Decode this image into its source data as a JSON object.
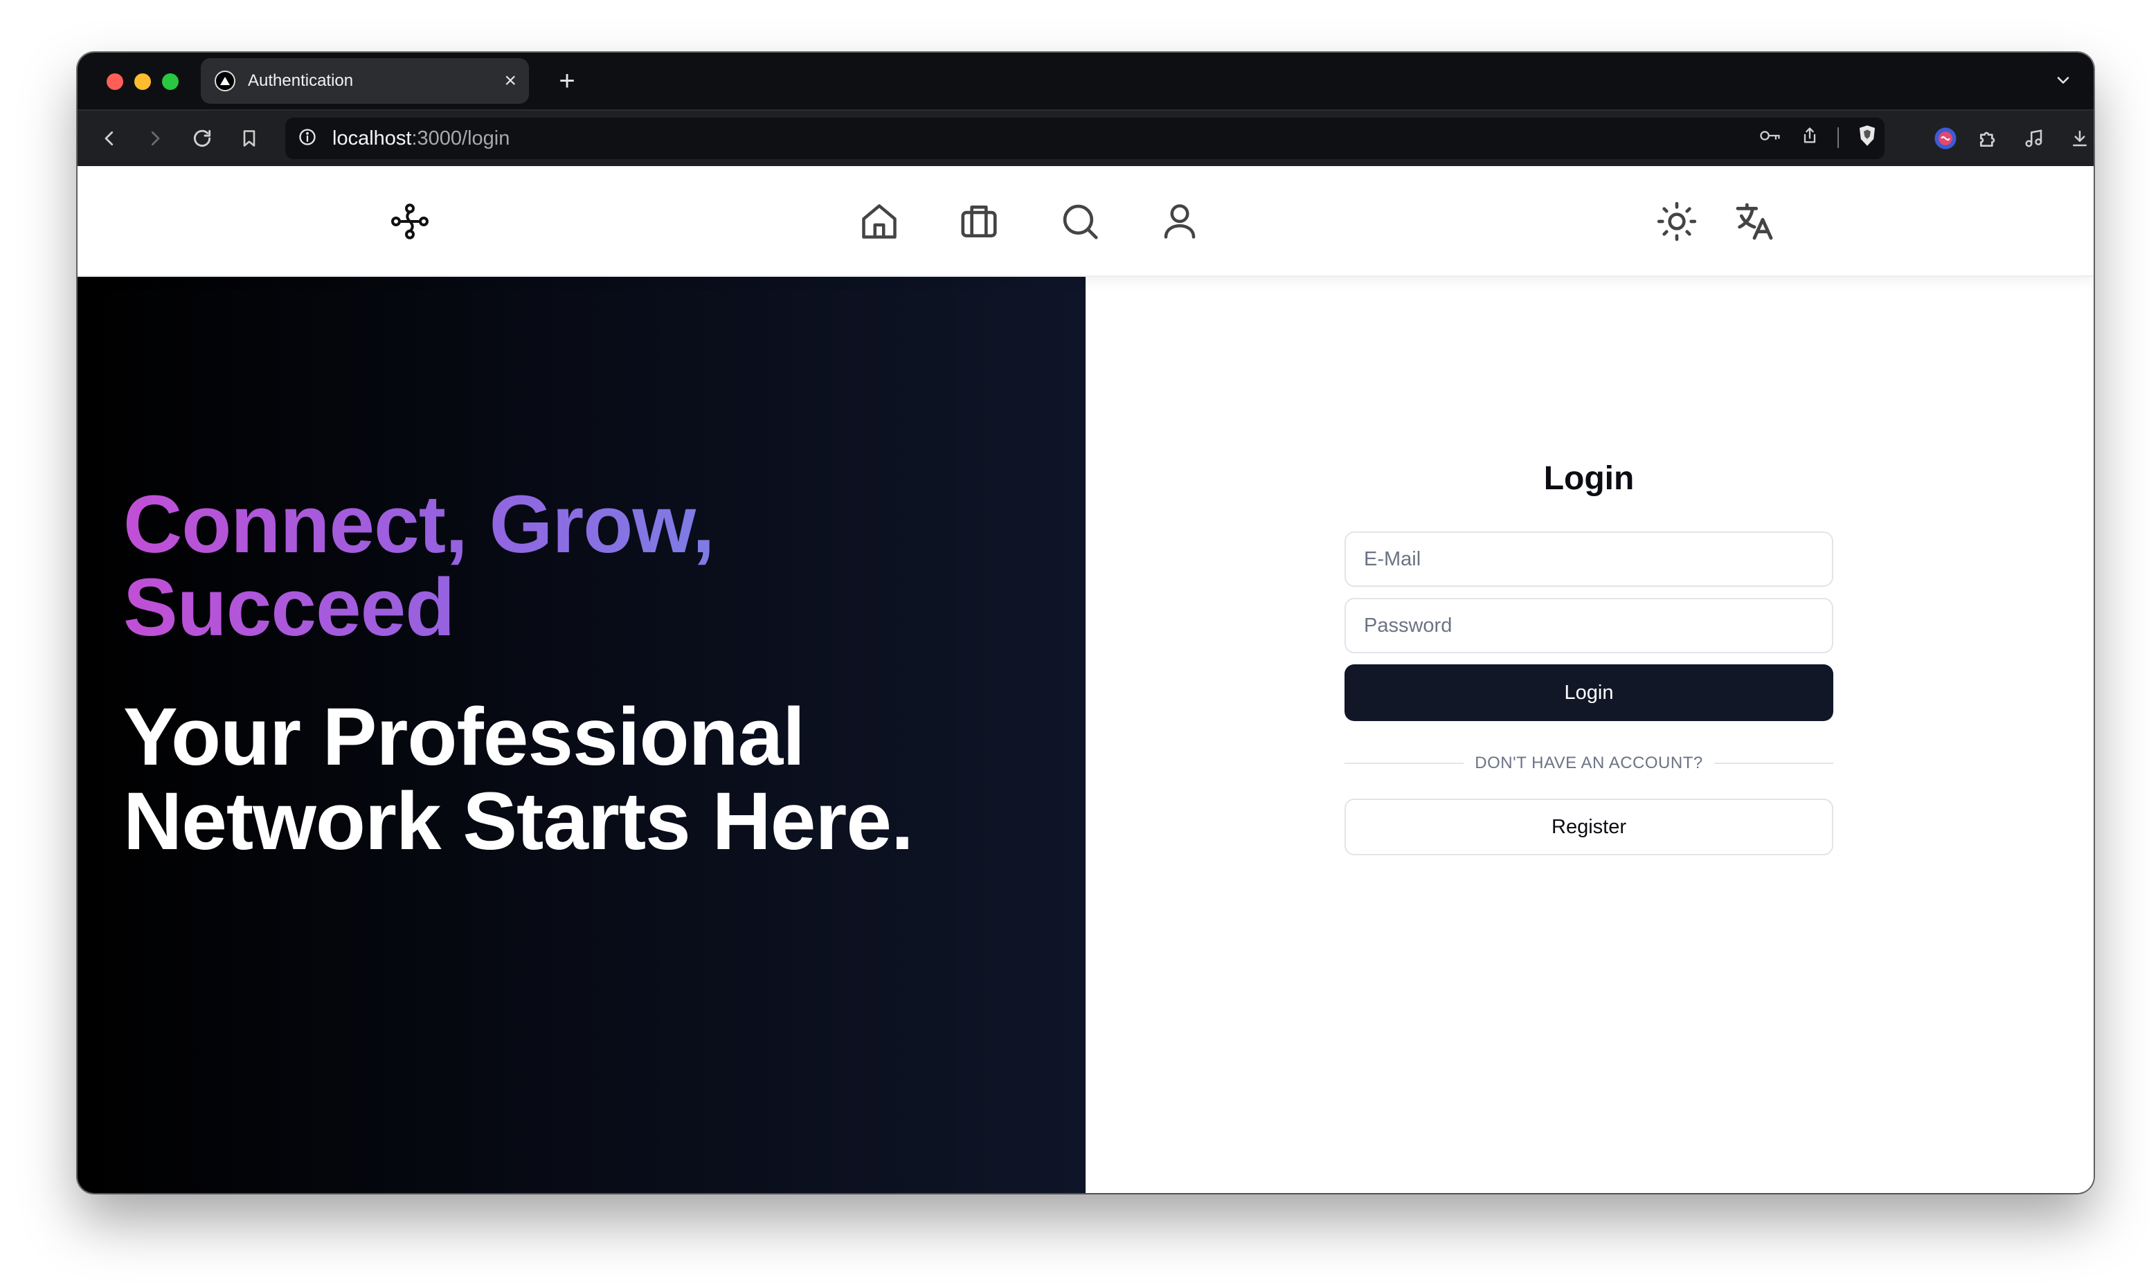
{
  "browser": {
    "tab_title": "Authentication",
    "tab_close_icon": "×",
    "new_tab_icon": "+",
    "url_host": "localhost",
    "url_path": ":3000/login"
  },
  "nav": {
    "logo_icon": "network-logo",
    "items": [
      "home-icon",
      "briefcase-icon",
      "search-icon",
      "user-icon"
    ],
    "actions": [
      "sun-icon",
      "translate-icon"
    ]
  },
  "hero": {
    "tagline": "Connect, Grow, Succeed",
    "headline": "Your Professional Network Starts Here."
  },
  "login": {
    "title": "Login",
    "email_placeholder": "E-Mail",
    "password_placeholder": "Password",
    "submit_label": "Login",
    "divider_text": "DON'T HAVE AN ACCOUNT?",
    "register_label": "Register"
  },
  "colors": {
    "primary_button": "#111727",
    "hero_gradient_start": "#c14fd6",
    "hero_gradient_end": "#6e8fe8"
  }
}
